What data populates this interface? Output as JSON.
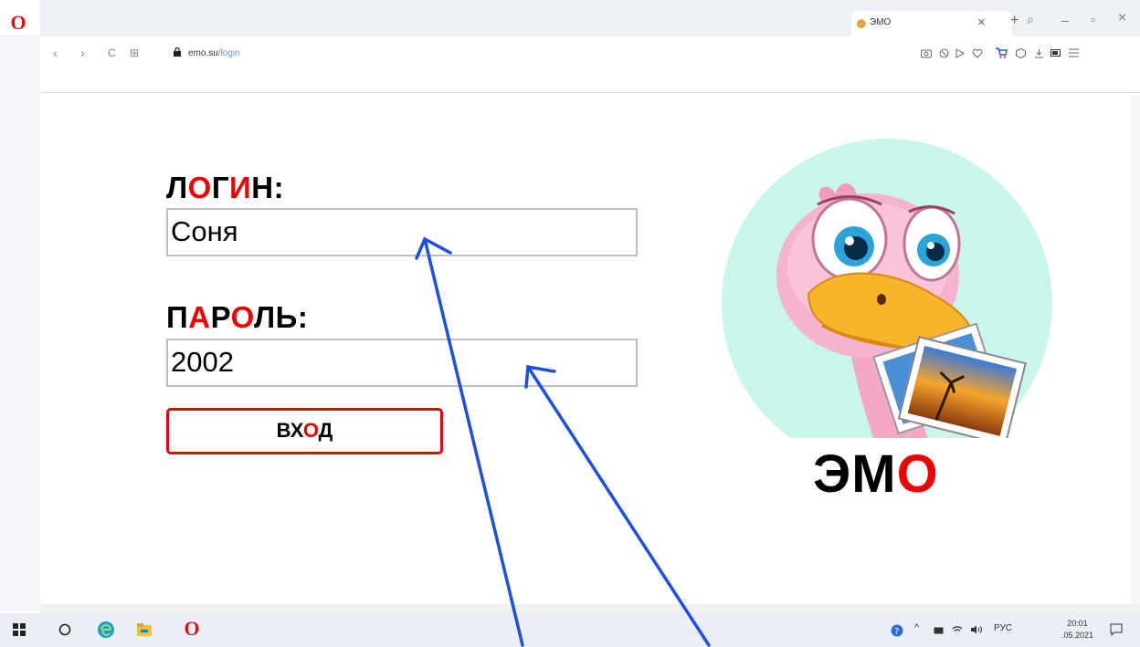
{
  "browser": {
    "tab_title": "ЭМО",
    "tab_close": "×",
    "new_tab": "+",
    "url_host": "emo.su",
    "url_path": "/login",
    "window_search": "⌕",
    "window_minimize": "_",
    "window_restore": "▫",
    "window_close": "×",
    "back": "‹",
    "forward": "›",
    "reload": "C",
    "grid": "⊞"
  },
  "form": {
    "login_label": [
      "Л",
      "О",
      "Г",
      "И",
      "Н:"
    ],
    "login_value": "Соня",
    "password_label": [
      "П",
      "А",
      "Р",
      "О",
      "ЛЬ:"
    ],
    "password_value": "2002",
    "submit_label": [
      "ВХ",
      "О",
      "Д"
    ]
  },
  "logo": {
    "text": [
      "ЭМ",
      "О"
    ]
  },
  "taskbar": {
    "lang": "РУС",
    "time": "20:01",
    "date": ".05.2021"
  },
  "colors": {
    "accent_red": "#e00000",
    "arrow_blue": "#1f4fe0",
    "mascot_bg": "#c9f5ec"
  }
}
